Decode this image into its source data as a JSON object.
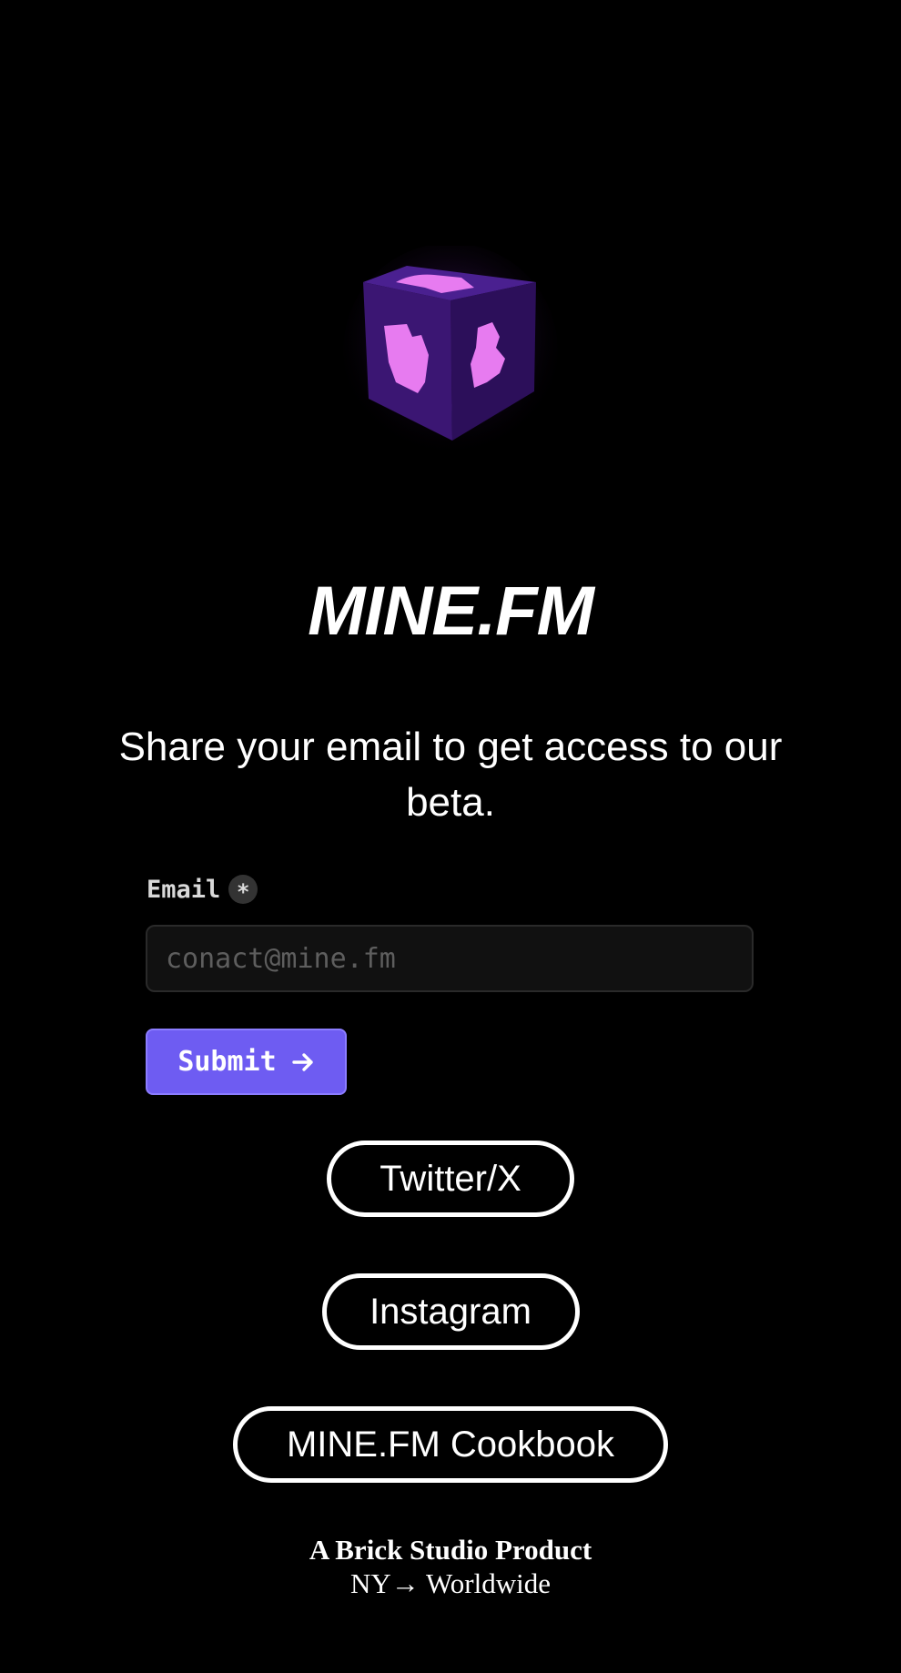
{
  "logo": {
    "icon": "glowing-purple-cube-icon",
    "accent": "#e77bf0",
    "body": "#3a1870"
  },
  "brand": {
    "title": "MINE.FM"
  },
  "tagline": "Share your email to get access to our beta.",
  "form": {
    "email_label": "Email",
    "required_marker": "*",
    "email_placeholder": "conact@mine.fm",
    "email_value": "",
    "submit_label": "Submit",
    "submit_icon": "arrow-right-icon",
    "submit_color": "#6e5cf2"
  },
  "links": {
    "twitter": "Twitter/X",
    "instagram": "Instagram",
    "cookbook": "MINE.FM Cookbook"
  },
  "footer": {
    "line1": "A Brick Studio Product",
    "line2": "NY→ Worldwide"
  }
}
